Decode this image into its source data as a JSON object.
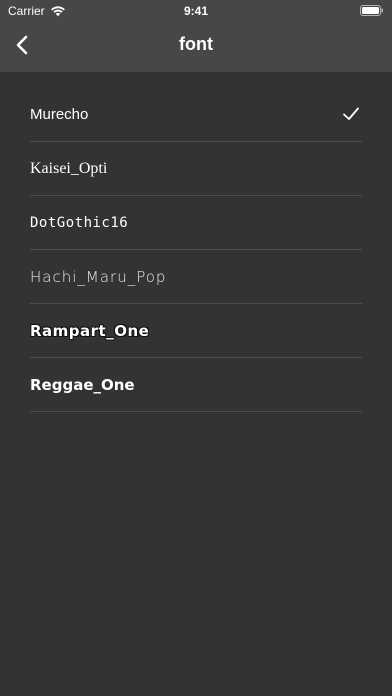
{
  "status": {
    "carrier": "Carrier",
    "time": "9:41"
  },
  "nav": {
    "title": "font"
  },
  "fonts": [
    {
      "label": "Murecho",
      "selected": true
    },
    {
      "label": "Kaisei_Opti",
      "selected": false
    },
    {
      "label": "DotGothic16",
      "selected": false
    },
    {
      "label": "Hachi_Maru_Pop",
      "selected": false
    },
    {
      "label": "Rampart_One",
      "selected": false
    },
    {
      "label": "Reggae_One",
      "selected": false
    }
  ],
  "icons": {
    "back": "chevron-left-icon",
    "check": "checkmark-icon",
    "wifi": "wifi-icon",
    "battery": "battery-icon"
  },
  "colors": {
    "background": "#333333",
    "navbar": "#474747",
    "separator": "#4d4d4d",
    "text": "#ffffff"
  }
}
